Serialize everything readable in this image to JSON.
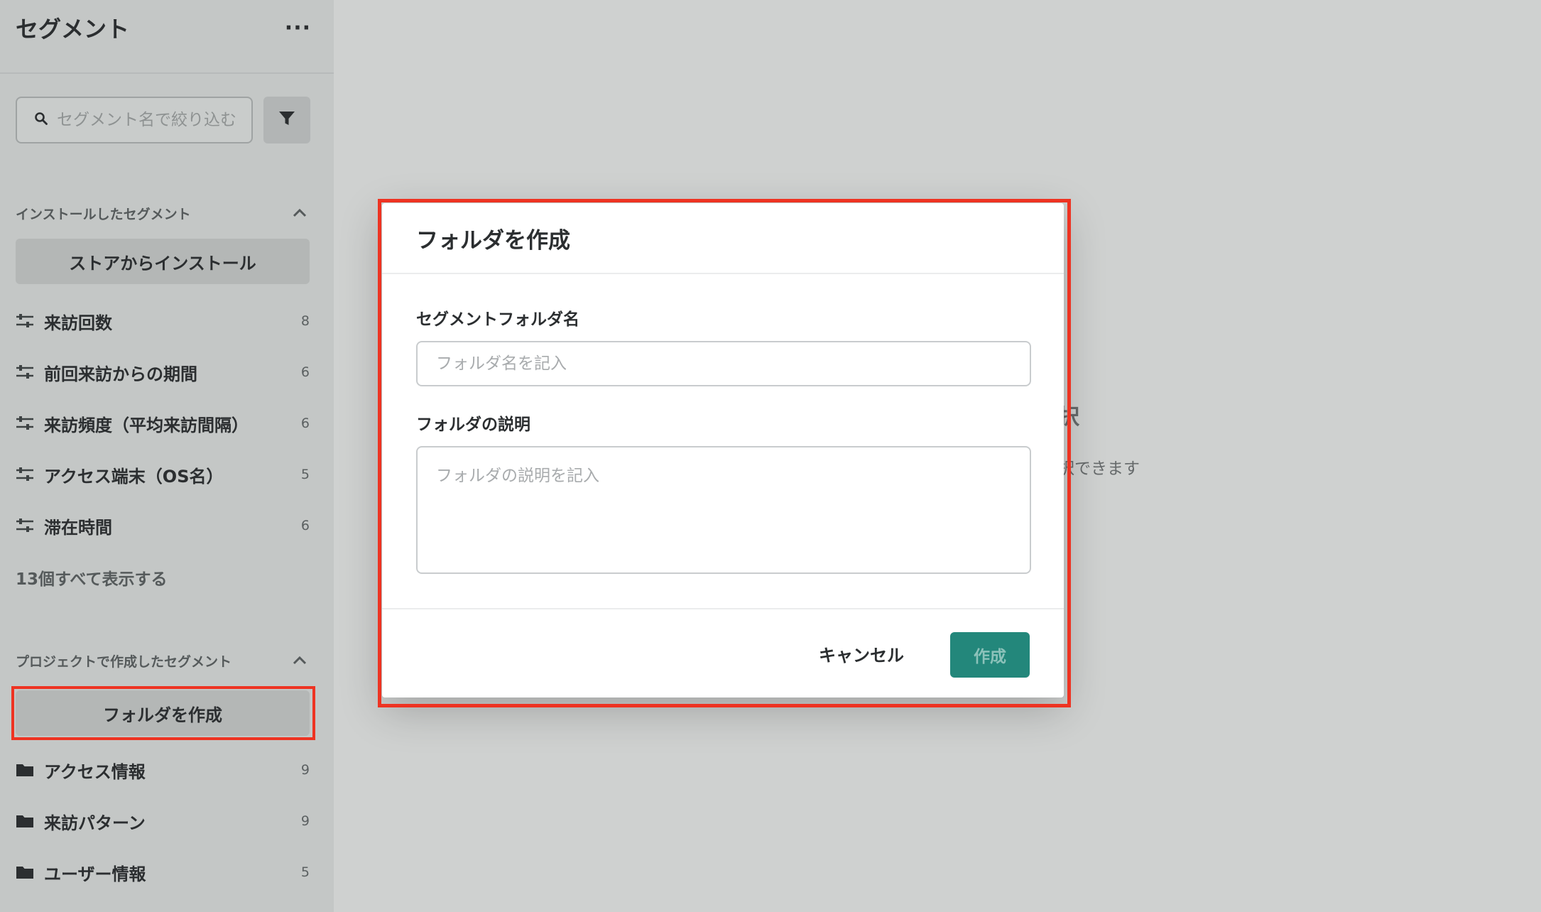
{
  "colors": {
    "accent": "#23877b",
    "highlight": "#ee3322",
    "overlay_bg": "#cfd1d0",
    "sidebar_bg": "#c4c7c6"
  },
  "sidebar": {
    "title": "セグメント",
    "more_label": "···",
    "search": {
      "placeholder": "セグメント名で絞り込む",
      "icon": "search-icon"
    },
    "filter_icon": "filter-icon",
    "installed": {
      "heading": "インストールしたセグメント",
      "install_button": "ストアからインストール",
      "items": [
        {
          "label": "来訪回数",
          "count": "8",
          "icon": "sliders-icon"
        },
        {
          "label": "前回来訪からの期間",
          "count": "6",
          "icon": "sliders-icon"
        },
        {
          "label": "来訪頻度（平均来訪間隔）",
          "count": "6",
          "icon": "sliders-icon"
        },
        {
          "label": "アクセス端末（OS名）",
          "count": "5",
          "icon": "sliders-icon"
        },
        {
          "label": "滞在時間",
          "count": "6",
          "icon": "sliders-icon"
        }
      ],
      "show_all": "13個すべて表示する"
    },
    "project": {
      "heading": "プロジェクトで作成したセグメント",
      "create_folder_button": "フォルダを作成",
      "folders": [
        {
          "label": "アクセス情報",
          "count": "9",
          "icon": "folder-icon"
        },
        {
          "label": "来訪パターン",
          "count": "9",
          "icon": "folder-icon"
        },
        {
          "label": "ユーザー情報",
          "count": "5",
          "icon": "folder-icon"
        }
      ]
    }
  },
  "main": {
    "heading_partial": "択",
    "sub_partial": "択できます"
  },
  "modal": {
    "title": "フォルダを作成",
    "name_label": "セグメントフォルダ名",
    "name_placeholder": "フォルダ名を記入",
    "name_value": "",
    "desc_label": "フォルダの説明",
    "desc_placeholder": "フォルダの説明を記入",
    "desc_value": "",
    "cancel_label": "キャンセル",
    "create_label": "作成"
  }
}
